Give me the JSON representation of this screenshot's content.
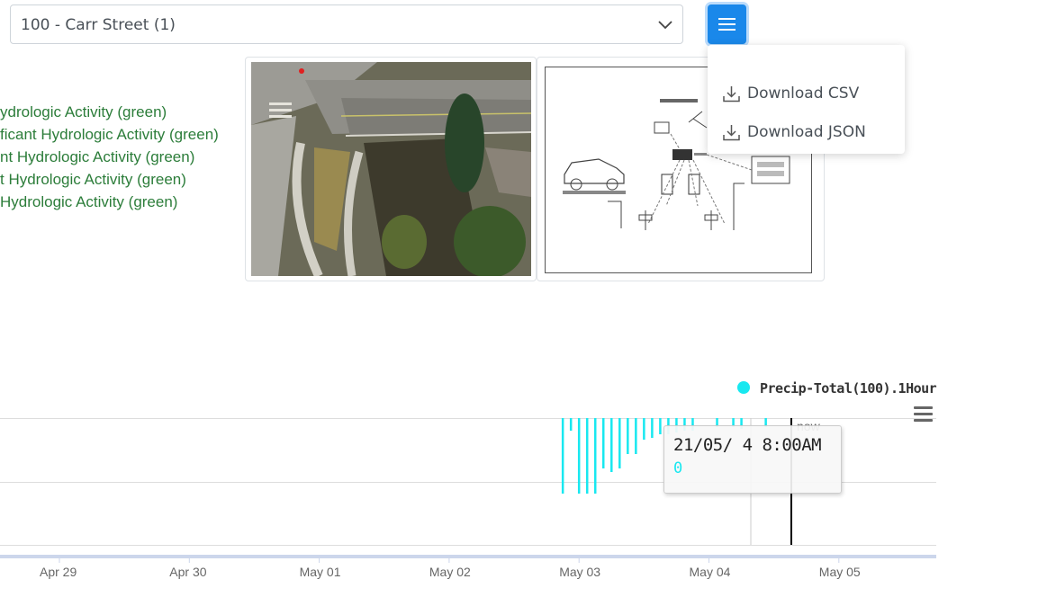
{
  "station_select": {
    "value": "100 - Carr Street (1)"
  },
  "menu": {
    "items": [
      {
        "label": "Download CSV",
        "icon": "download-icon"
      },
      {
        "label": "Download JSON",
        "icon": "download-icon"
      }
    ]
  },
  "activity_legend": [
    "ydrologic Activity (green)",
    "ficant Hydrologic Activity (green)",
    "nt Hydrologic Activity (green)",
    "t Hydrologic Activity (green)",
    " Hydrologic Activity (green)"
  ],
  "colors": {
    "accent": "#1a88ea",
    "legend_green": "#2c7d3a",
    "series": "#18e8f0"
  },
  "chart_data": {
    "type": "bar",
    "series": [
      {
        "name": "Precip-Total(100).1Hour"
      }
    ],
    "x_ticks": [
      "Apr 29",
      "Apr 30",
      "May 01",
      "May 02",
      "May 03",
      "May 04",
      "May 05"
    ],
    "now_label": "now",
    "tooltip": {
      "date": "21/05/ 4 8:00AM",
      "value": "0"
    },
    "bars_hours_since_may03": [
      {
        "t": -0.5,
        "v": 0.42
      },
      {
        "t": -0.25,
        "v": 0.07
      },
      {
        "t": 0.0,
        "v": 0.42
      },
      {
        "t": 0.25,
        "v": 0.42
      },
      {
        "t": 0.5,
        "v": 0.42
      },
      {
        "t": 0.75,
        "v": 0.28
      },
      {
        "t": 1.0,
        "v": 0.3
      },
      {
        "t": 1.25,
        "v": 0.28
      },
      {
        "t": 1.5,
        "v": 0.2
      },
      {
        "t": 1.75,
        "v": 0.2
      },
      {
        "t": 2.0,
        "v": 0.12
      },
      {
        "t": 2.25,
        "v": 0.11
      },
      {
        "t": 2.5,
        "v": 0.09
      },
      {
        "t": 2.75,
        "v": 0.09
      },
      {
        "t": 3.0,
        "v": 0.08
      },
      {
        "t": 3.25,
        "v": 0.07
      },
      {
        "t": 3.5,
        "v": 0.07
      },
      {
        "t": 4.25,
        "v": 0.05
      },
      {
        "t": 4.75,
        "v": 0.05
      },
      {
        "t": 5.0,
        "v": 0.06
      },
      {
        "t": 5.75,
        "v": 0.05
      }
    ]
  }
}
